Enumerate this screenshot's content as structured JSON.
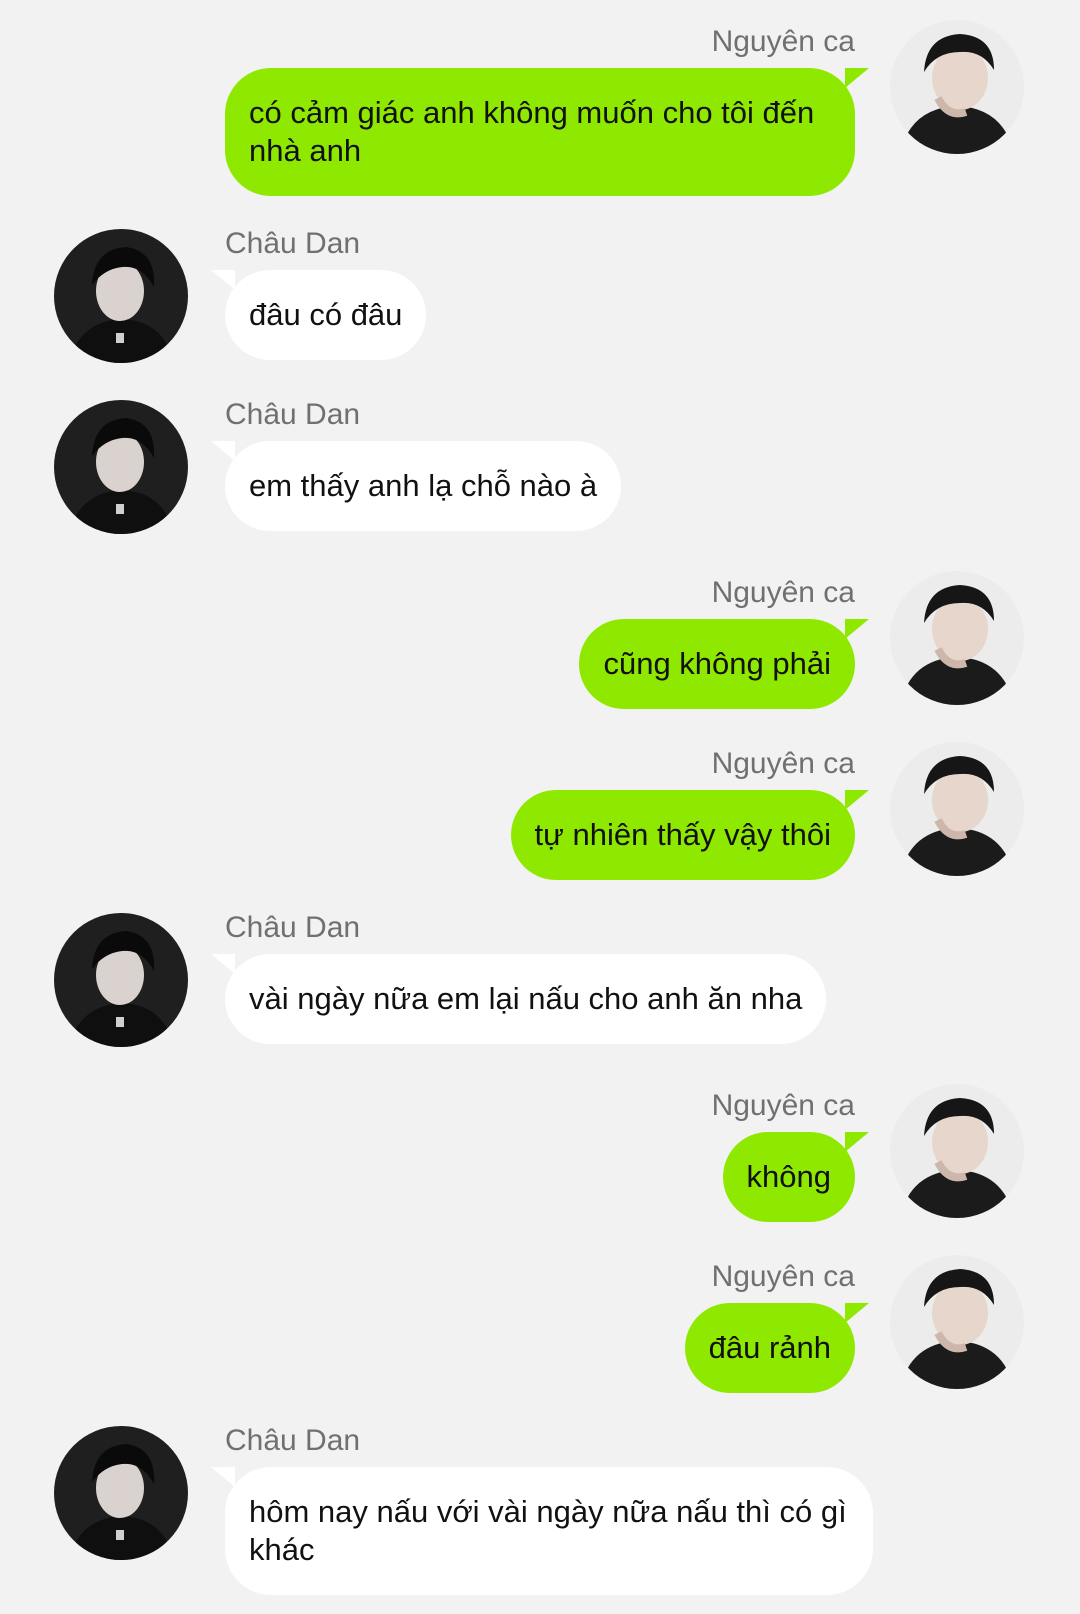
{
  "app": {
    "background_color": "#f2f2f2",
    "sent_bubble_color": "#8fe800",
    "received_bubble_color": "#ffffff"
  },
  "messages": [
    {
      "sender": "Nguyên ca",
      "side": "right",
      "avatar": "avatar-nguyen-ca",
      "text": "có cảm giác anh không muốn cho tôi đến nhà anh"
    },
    {
      "sender": "Châu Dan",
      "side": "left",
      "avatar": "avatar-chau-dan",
      "text": "đâu có đâu"
    },
    {
      "sender": "Châu Dan",
      "side": "left",
      "avatar": "avatar-chau-dan",
      "text": "em thấy anh lạ chỗ nào à"
    },
    {
      "sender": "Nguyên ca",
      "side": "right",
      "avatar": "avatar-nguyen-ca",
      "text": "cũng không phải"
    },
    {
      "sender": "Nguyên ca",
      "side": "right",
      "avatar": "avatar-nguyen-ca",
      "text": "tự nhiên thấy vậy thôi"
    },
    {
      "sender": "Châu Dan",
      "side": "left",
      "avatar": "avatar-chau-dan",
      "text": "vài ngày nữa em lại nấu cho anh ăn nha"
    },
    {
      "sender": "Nguyên ca",
      "side": "right",
      "avatar": "avatar-nguyen-ca",
      "text": "không"
    },
    {
      "sender": "Nguyên ca",
      "side": "right",
      "avatar": "avatar-nguyen-ca",
      "text": "đâu rảnh"
    },
    {
      "sender": "Châu Dan",
      "side": "left",
      "avatar": "avatar-chau-dan",
      "text": "hôm nay nấu với vài ngày nữa nấu thì có gì khác"
    }
  ]
}
